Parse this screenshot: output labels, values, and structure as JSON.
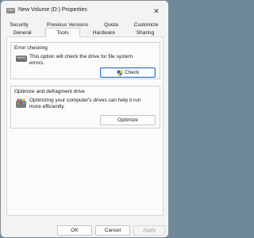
{
  "window": {
    "title": "New Volume (D:) Properties",
    "close_glyph": "✕"
  },
  "tabs": {
    "row1": [
      {
        "label": "Security"
      },
      {
        "label": "Previous Versions"
      },
      {
        "label": "Quota"
      },
      {
        "label": "Customize"
      }
    ],
    "row2": [
      {
        "label": "General"
      },
      {
        "label": "Tools"
      },
      {
        "label": "Hardware"
      },
      {
        "label": "Sharing"
      }
    ],
    "active": "Tools"
  },
  "error_checking": {
    "title": "Error checking",
    "description": "This option will check the drive for file system errors.",
    "button_label": "Check",
    "icon": "drive-icon",
    "button_icon": "shield-icon"
  },
  "optimize": {
    "title": "Optimize and defragment drive",
    "description": "Optimizing your computer's drives can help it run more efficiently.",
    "button_label": "Optimize",
    "icon": "defrag-icon"
  },
  "footer": {
    "ok_label": "OK",
    "cancel_label": "Cancel",
    "apply_label": "Apply"
  },
  "colors": {
    "accent": "#2f6fbf"
  }
}
